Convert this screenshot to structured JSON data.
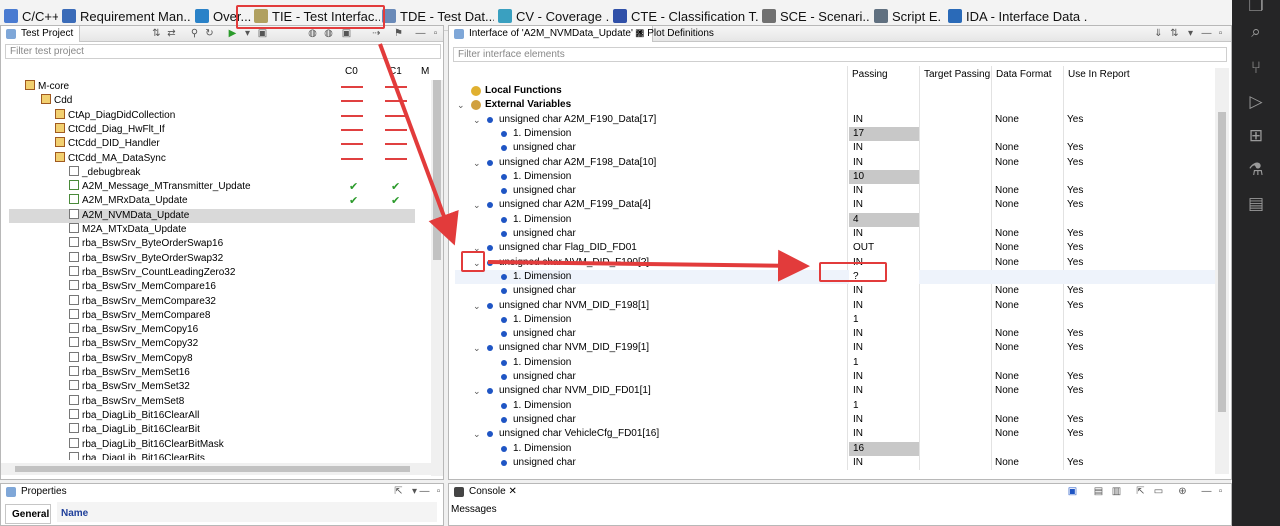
{
  "perspective_tabs": [
    {
      "label": "C/C++"
    },
    {
      "label": "Requirement Man..."
    },
    {
      "label": "Over..."
    },
    {
      "label": "TIE - Test Interfac..."
    },
    {
      "label": "TDE - Test Dat..."
    },
    {
      "label": "CV - Coverage ..."
    },
    {
      "label": "CTE - Classification T..."
    },
    {
      "label": "SCE - Scenari..."
    },
    {
      "label": "Script E..."
    },
    {
      "label": "IDA - Interface Data ..."
    }
  ],
  "left": {
    "view_title": "Test Project",
    "filter_placeholder": "Filter test project",
    "columns": [
      "C0",
      "C1",
      "M"
    ],
    "tree": [
      {
        "label": "M-core",
        "icon": "module-icon"
      },
      {
        "label": "Cdd",
        "icon": "folder-icon"
      },
      {
        "label": "CtAp_DiagDidCollection",
        "icon": "file-icon"
      },
      {
        "label": "CtCdd_Diag_HwFlt_If",
        "icon": "file-icon"
      },
      {
        "label": "CtCdd_DID_Handler",
        "icon": "file-icon"
      },
      {
        "label": "CtCdd_MA_DataSync",
        "icon": "file-icon"
      },
      {
        "label": "_debugbreak",
        "icon": "function-icon"
      },
      {
        "label": "A2M_Message_MTransmitter_Update",
        "icon": "function-checked-icon"
      },
      {
        "label": "A2M_MRxData_Update",
        "icon": "function-checked-icon"
      },
      {
        "label": "A2M_NVMData_Update",
        "icon": "function-icon"
      },
      {
        "label": "M2A_MTxData_Update",
        "icon": "function-icon"
      },
      {
        "label": "rba_BswSrv_ByteOrderSwap16",
        "icon": "function-icon"
      },
      {
        "label": "rba_BswSrv_ByteOrderSwap32",
        "icon": "function-icon"
      },
      {
        "label": "rba_BswSrv_CountLeadingZero32",
        "icon": "function-icon"
      },
      {
        "label": "rba_BswSrv_MemCompare16",
        "icon": "function-icon"
      },
      {
        "label": "rba_BswSrv_MemCompare32",
        "icon": "function-icon"
      },
      {
        "label": "rba_BswSrv_MemCompare8",
        "icon": "function-icon"
      },
      {
        "label": "rba_BswSrv_MemCopy16",
        "icon": "function-icon"
      },
      {
        "label": "rba_BswSrv_MemCopy32",
        "icon": "function-icon"
      },
      {
        "label": "rba_BswSrv_MemCopy8",
        "icon": "function-icon"
      },
      {
        "label": "rba_BswSrv_MemSet16",
        "icon": "function-icon"
      },
      {
        "label": "rba_BswSrv_MemSet32",
        "icon": "function-icon"
      },
      {
        "label": "rba_BswSrv_MemSet8",
        "icon": "function-icon"
      },
      {
        "label": "rba_DiagLib_Bit16ClearAll",
        "icon": "function-icon"
      },
      {
        "label": "rba_DiagLib_Bit16ClearBit",
        "icon": "function-icon"
      },
      {
        "label": "rba_DiagLib_Bit16ClearBitMask",
        "icon": "function-icon"
      },
      {
        "label": "rba_DiagLib_Bit16ClearBits",
        "icon": "function-icon"
      }
    ]
  },
  "right": {
    "tab_active": "Interface of 'A2M_NVMData_Update'",
    "tab_other": "Plot Definitions",
    "filter_placeholder": "Filter interface elements",
    "columns": [
      "Passing",
      "Target Passing",
      "Data Format",
      "Use In Report"
    ],
    "rows": [
      {
        "label": "Local Functions",
        "passing": "",
        "format": "",
        "report": ""
      },
      {
        "label": "External Variables",
        "passing": "",
        "format": "",
        "report": ""
      },
      {
        "label": "unsigned char A2M_F190_Data[17]",
        "passing": "IN",
        "format": "None",
        "report": "Yes"
      },
      {
        "label": "1. Dimension",
        "passing": "17",
        "format": "",
        "report": ""
      },
      {
        "label": "unsigned char",
        "passing": "IN",
        "format": "None",
        "report": "Yes"
      },
      {
        "label": "unsigned char A2M_F198_Data[10]",
        "passing": "IN",
        "format": "None",
        "report": "Yes"
      },
      {
        "label": "1. Dimension",
        "passing": "10",
        "format": "",
        "report": ""
      },
      {
        "label": "unsigned char",
        "passing": "IN",
        "format": "None",
        "report": "Yes"
      },
      {
        "label": "unsigned char A2M_F199_Data[4]",
        "passing": "IN",
        "format": "None",
        "report": "Yes"
      },
      {
        "label": "1. Dimension",
        "passing": "4",
        "format": "",
        "report": ""
      },
      {
        "label": "unsigned char",
        "passing": "IN",
        "format": "None",
        "report": "Yes"
      },
      {
        "label": "unsigned char Flag_DID_FD01",
        "passing": "OUT",
        "format": "None",
        "report": "Yes"
      },
      {
        "label": "unsigned char NVM_DID_F190[?]",
        "passing": "IN",
        "format": "None",
        "report": "Yes"
      },
      {
        "label": "1. Dimension",
        "passing": "?",
        "format": "",
        "report": ""
      },
      {
        "label": "unsigned char",
        "passing": "IN",
        "format": "None",
        "report": "Yes"
      },
      {
        "label": "unsigned char NVM_DID_F198[1]",
        "passing": "IN",
        "format": "None",
        "report": "Yes"
      },
      {
        "label": "1. Dimension",
        "passing": "1",
        "format": "",
        "report": ""
      },
      {
        "label": "unsigned char",
        "passing": "IN",
        "format": "None",
        "report": "Yes"
      },
      {
        "label": "unsigned char NVM_DID_F199[1]",
        "passing": "IN",
        "format": "None",
        "report": "Yes"
      },
      {
        "label": "1. Dimension",
        "passing": "1",
        "format": "",
        "report": ""
      },
      {
        "label": "unsigned char",
        "passing": "IN",
        "format": "None",
        "report": "Yes"
      },
      {
        "label": "unsigned char NVM_DID_FD01[1]",
        "passing": "IN",
        "format": "None",
        "report": "Yes"
      },
      {
        "label": "1. Dimension",
        "passing": "1",
        "format": "",
        "report": ""
      },
      {
        "label": "unsigned char",
        "passing": "IN",
        "format": "None",
        "report": "Yes"
      },
      {
        "label": "unsigned char VehicleCfg_FD01[16]",
        "passing": "IN",
        "format": "None",
        "report": "Yes"
      },
      {
        "label": "1. Dimension",
        "passing": "16",
        "format": "",
        "report": ""
      },
      {
        "label": "unsigned char",
        "passing": "IN",
        "format": "None",
        "report": "Yes"
      }
    ]
  },
  "bottom_left": {
    "title": "Properties",
    "tab": "General",
    "column": "Name"
  },
  "bottom_right": {
    "title": "Console",
    "sub": "Messages"
  },
  "colors": {
    "accent_blue": "#1f55c4",
    "annotation_red": "#e23b3b",
    "selection": "#d9d9d9",
    "gray_cell": "#c8c8c8"
  }
}
